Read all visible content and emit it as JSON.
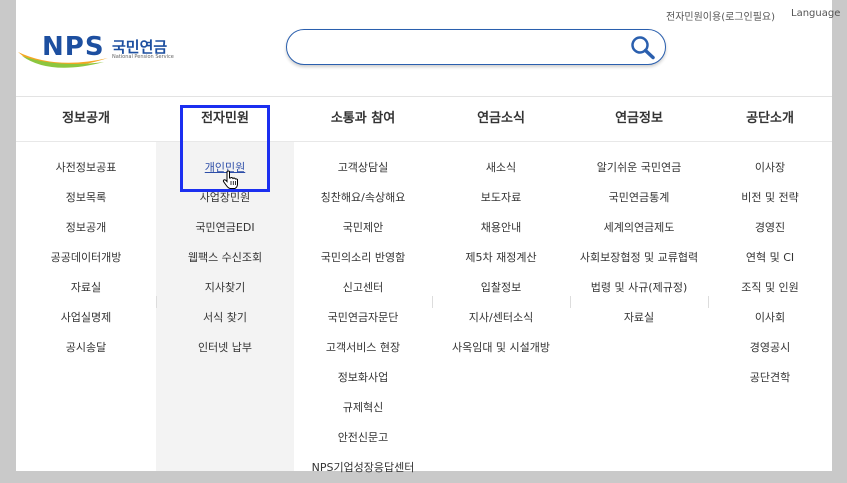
{
  "header": {
    "util_links": [
      "전자민원이용(로그인필요)",
      "Language"
    ],
    "logo": {
      "mark": "NPS",
      "name_kor": "국민연금",
      "name_eng": "National Pension Service"
    },
    "search": {
      "value": "",
      "placeholder": ""
    }
  },
  "colors": {
    "brand_blue": "#1d4fa0",
    "highlight_box": "#1b2ff0",
    "active_link": "#2d4ea8"
  },
  "menus": [
    {
      "title": "정보공개",
      "items": [
        "사전정보공표",
        "정보목록",
        "정보공개",
        "공공데이터개방",
        "자료실",
        "사업실명제",
        "공시송달"
      ]
    },
    {
      "title": "전자민원",
      "items": [
        "개인민원",
        "사업장민원",
        "국민연금EDI",
        "웹팩스 수신조회",
        "지사찾기",
        "서식 찾기",
        "인터넷 납부"
      ]
    },
    {
      "title": "소통과 참여",
      "items": [
        "고객상담실",
        "칭찬해요/속상해요",
        "국민제안",
        "국민의소리 반영함",
        "신고센터",
        "국민연금자문단",
        "고객서비스 현장",
        "정보화사업",
        "규제혁신",
        "안전신문고",
        "NPS기업성장응답센터"
      ]
    },
    {
      "title": "연금소식",
      "items": [
        "새소식",
        "보도자료",
        "채용안내",
        "제5차 재정계산",
        "입찰정보",
        "지사/센터소식",
        "사옥임대 및 시설개방"
      ]
    },
    {
      "title": "연금정보",
      "items": [
        "알기쉬운 국민연금",
        "국민연금통계",
        "세계의연금제도",
        "사회보장협정 및 교류협력",
        "법령 및 사규(제규정)",
        "자료실"
      ]
    },
    {
      "title": "공단소개",
      "items": [
        "이사장",
        "비전 및 전략",
        "경영진",
        "연혁 및 CI",
        "조직 및 인원",
        "이사회",
        "경영공시",
        "공단견학"
      ]
    }
  ],
  "active": {
    "menu": 1,
    "item": 0
  }
}
